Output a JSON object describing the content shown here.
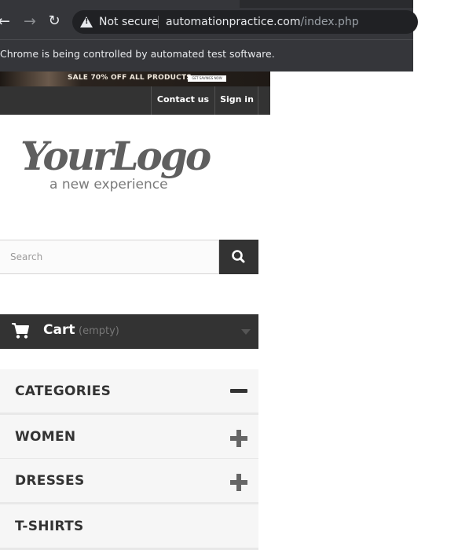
{
  "browser": {
    "security_label": "Not secure",
    "url_host": "automationpractice.com",
    "url_path": "/index.php",
    "infobar_text": "Chrome is being controlled by automated test software."
  },
  "banner": {
    "text": "SALE 70% OFF ALL PRODUCTS",
    "button_label": "GET SAVINGS NOW"
  },
  "topnav": {
    "contact_label": "Contact us",
    "signin_label": "Sign in"
  },
  "logo": {
    "main": "YourLogo",
    "tagline": "a new experience"
  },
  "search": {
    "placeholder": "Search"
  },
  "cart": {
    "label": "Cart",
    "status": "(empty)"
  },
  "categories": {
    "header": "CATEGORIES",
    "items": [
      "WOMEN",
      "DRESSES",
      "T-SHIRTS"
    ]
  },
  "colors": {
    "dark": "#333333",
    "chrome_bg": "#35363a",
    "category_bg": "#f6f6f6"
  }
}
